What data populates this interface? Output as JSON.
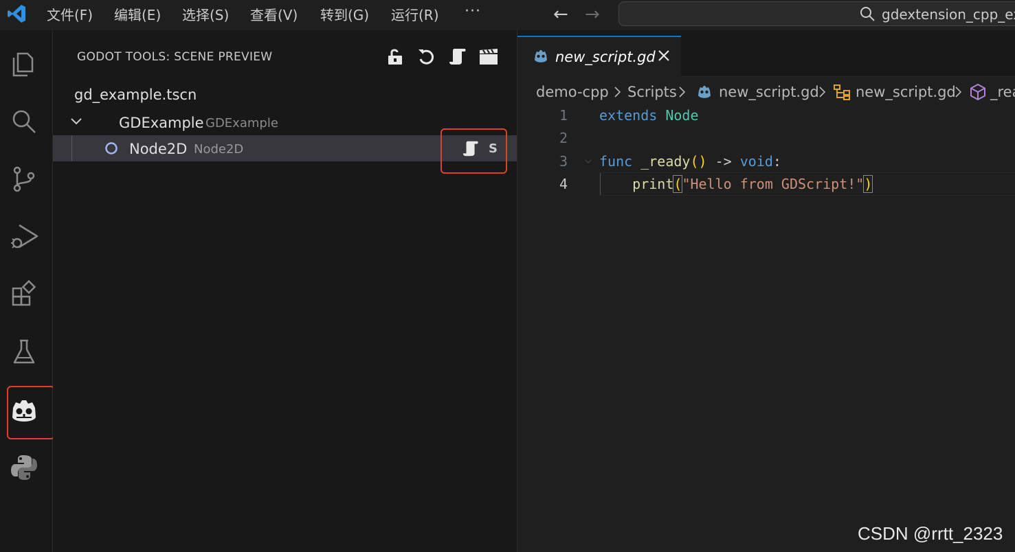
{
  "menu": {
    "items": [
      "文件(F)",
      "编辑(E)",
      "选择(S)",
      "查看(V)",
      "转到(G)",
      "运行(R)"
    ],
    "more": "···"
  },
  "nav": {
    "back": "←",
    "forward": "→"
  },
  "search": {
    "text": "gdextension_cpp_exa"
  },
  "activity_bar": {
    "icons": [
      "explorer-icon",
      "search-icon",
      "source-control-icon",
      "run-debug-icon",
      "extensions-icon",
      "testing-icon",
      "godot-icon",
      "python-icon"
    ],
    "active": "godot-icon"
  },
  "sidebar": {
    "title": "GODOT TOOLS: SCENE PREVIEW",
    "tools": [
      "lock-icon",
      "refresh-icon",
      "script-icon",
      "scene-clapper-icon"
    ],
    "scene_file": "gd_example.tscn",
    "tree": {
      "root": {
        "name": "GDExample",
        "type": "GDExample",
        "expanded": true
      },
      "child": {
        "name": "Node2D",
        "type": "Node2D",
        "badge": "S",
        "selected": true
      }
    }
  },
  "editor": {
    "tab": {
      "label": "new_script.gd"
    },
    "breadcrumb": [
      "demo-cpp",
      "Scripts",
      "new_script.gd",
      "new_script.gd",
      "_rea"
    ],
    "line_numbers": [
      "1",
      "2",
      "3",
      "4"
    ],
    "current_line": 4,
    "code": {
      "l1": {
        "kw": "extends",
        "type": "Node"
      },
      "l3": {
        "kw": "func",
        "name": "_ready",
        "open": "(",
        "close": ")",
        "arrow": "->",
        "ret": "void",
        "colon": ":"
      },
      "l4": {
        "indent": "    ",
        "fn": "print",
        "open": "(",
        "str": "\"Hello from GDScript!\"",
        "close": ")"
      }
    }
  },
  "colors": {
    "accent": "#0078d4",
    "highlight_border": "#e0402a",
    "keyword": "#569cd6",
    "type": "#4ec9b0",
    "function": "#dcdcaa",
    "string": "#ce9178",
    "bracket": "#ffd700"
  },
  "watermark": "CSDN @rrtt_2323"
}
